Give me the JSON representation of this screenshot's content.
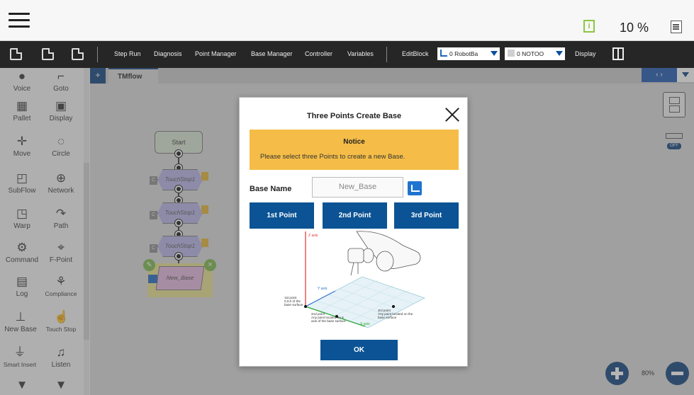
{
  "topbar": {
    "speed": "10 %",
    "info_letter": "i"
  },
  "toolbar": {
    "items": [
      "Step Run",
      "Diagnosis",
      "Point Manager",
      "Base Manager",
      "Controller",
      "Variables",
      "EditBlock",
      "Display"
    ],
    "robot_base_select": "0 RobotBa",
    "tool_select": "0 NOTOO"
  },
  "palette": {
    "items": [
      "Voice",
      "Goto",
      "Pallet",
      "Display",
      "Move",
      "Circle",
      "SubFlow",
      "Network",
      "Warp",
      "Path",
      "Command",
      "F-Point",
      "Log",
      "Compliance",
      "New Base",
      "Touch Stop",
      "Smart Insert",
      "Listen"
    ]
  },
  "canvas": {
    "tab_label": "TMflow",
    "start_label": "Start",
    "touch_label": "TouchStop1",
    "base_node_label": "New_Base",
    "cbox_label": "C",
    "nav_label": "‹  ›",
    "zoom": "80%",
    "off_label": "OFF"
  },
  "dialog": {
    "title": "Three Points Create Base",
    "notice_title": "Notice",
    "notice_message": "Please select three Points to create a new Base.",
    "base_name_label": "Base Name",
    "base_name_value": "New_Base",
    "point_buttons": [
      "1st Point",
      "2nd Point",
      "3rd Point"
    ],
    "ok_label": "OK",
    "diagram": {
      "z_axis": "Z axis",
      "y_axis": "Y axis",
      "x_axis": "X axis",
      "p1_lines": [
        "1st point",
        "0,0,0 of the",
        "base surface"
      ],
      "p2_lines": [
        "2nd point",
        "Any point located on X",
        "axis of the base surface"
      ],
      "p3_lines": [
        "3rd point",
        "Any point located on the",
        "base surface"
      ]
    }
  },
  "colors": {
    "toolbar_bg": "#262626",
    "accent_blue": "#0b5394",
    "notice_yellow": "#f5bd47",
    "axis_red": "#e03030",
    "axis_green": "#2aa830",
    "axis_blue": "#3070d0"
  }
}
